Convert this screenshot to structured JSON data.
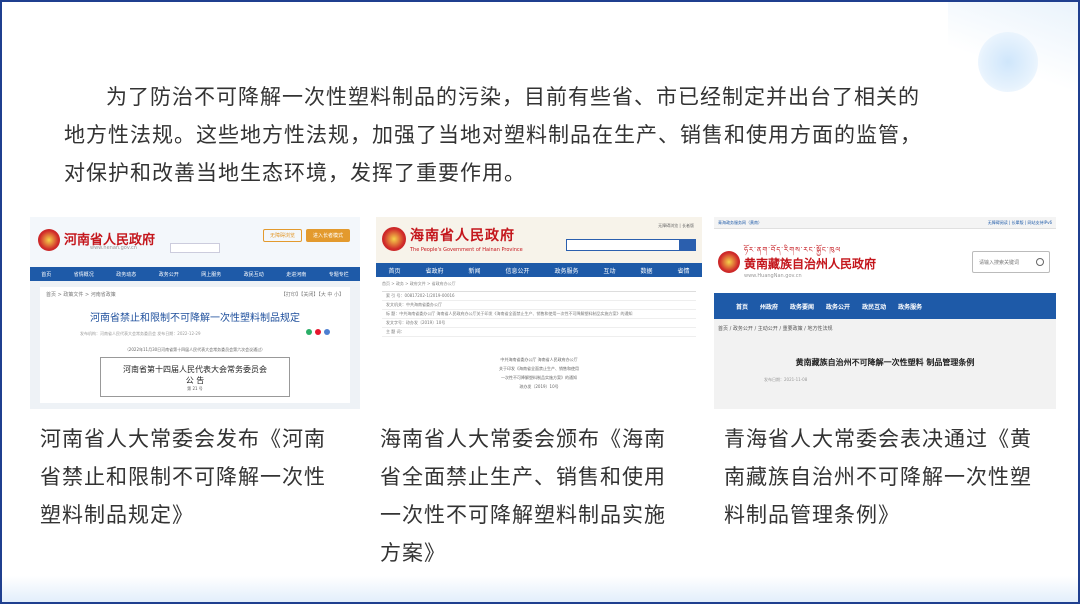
{
  "intro": {
    "line1": "为了防治不可降解一次性塑料制品的污染，目前有些省、市已经制定并出台了相关的",
    "line2": "地方性法规。这些地方性法规，加强了当地对塑料制品在生产、销售和使用方面的监管，",
    "line3": "对保护和改善当地生态环境，发挥了重要作用。"
  },
  "shots": {
    "henan": {
      "site_title": "河南省人民政府",
      "url": "www.henan.gov.cn",
      "btn1": "无障碍浏览",
      "btn2": "进入长者模式",
      "nav": [
        "首页",
        "省情概况",
        "政务动态",
        "政务公开",
        "网上服务",
        "政民互动",
        "走进河南",
        "专题专栏"
      ],
      "crumb": "首页 > 政策文件 > 河南省政策",
      "crumb_right": "【打印】【关闭】【大 中 小】",
      "doc_title": "河南省禁止和限制不可降解一次性塑料制品规定",
      "meta": "发布机构：河南省人民代表大会常务委员会 发布日期：2022-12-29",
      "sub": "（2022年11月30日河南省第十四届人民代表大会常务委员会第六次会议通过）",
      "box_line1": "河南省第十四届人民代表大会常务委员会",
      "box_line2": "公      告",
      "box_line3": "第 21 号"
    },
    "hainan": {
      "site_title": "海南省人民政府",
      "en_title": "The People's Government of Hainan Province",
      "top_links": "无障碍浏览 | 长者版",
      "nav": [
        "首页",
        "省政府",
        "新闻",
        "信息公开",
        "政务服务",
        "互动",
        "数据",
        "省情"
      ],
      "crumb": "首页 > 政务 > 政府文件 > 省政府办公厅",
      "rows": [
        "索 引 号：00817202-1/2019-00016",
        "发文机关：中共海南省委办公厅",
        "标    题：中共海南省委办公厅 海南省人民政府办公厅关于印发《海南省全面禁止生产、销售和使用一次性不可降解塑料制品实施方案》的通知",
        "发文字号：琼办发〔2019〕10号",
        "主 题 词："
      ],
      "center1": "中共海南省委办公厅 海南省人民政府办公厅",
      "center2": "关于印发《海南省全面禁止生产、销售和使用",
      "center3": "一次性不可降解塑料制品实施方案》的通知",
      "center4": "琼办发〔2019〕10号"
    },
    "qinghai": {
      "top_left": "青海政务服务网（黄南）",
      "top_right": "无障碍阅读 | 长辈版 | 网站支持IPv6",
      "tibetan": "ཧོར་ནག་བོད་རིགས་རང་སྐྱོང་ཁུལ",
      "site_title": "黄南藏族自治州人民政府",
      "url": "www.HuangNan.gov.cn",
      "search_placeholder": "请输入搜索关键词",
      "nav": [
        "首页",
        "州政府",
        "政务要闻",
        "政务公开",
        "政民互动",
        "政务服务"
      ],
      "crumb": "首页 / 政务公开 / 主动公开 / 重要政策 / 地方性法规",
      "doc_title": "黄南藏族自治州不可降解一次性塑料 制品管理条例",
      "meta": "发布日期：2021-11-08"
    }
  },
  "captions": {
    "henan": "河南省人大常委会发布《河南省禁止和限制不可降解一次性塑料制品规定》",
    "hainan": "海南省人大常委会颁布《海南省全面禁止生产、销售和使用一次性不可降解塑料制品实施方案》",
    "qinghai": "青海省人大常委会表决通过《黄南藏族自治州不可降解一次性塑料制品管理条例》"
  }
}
